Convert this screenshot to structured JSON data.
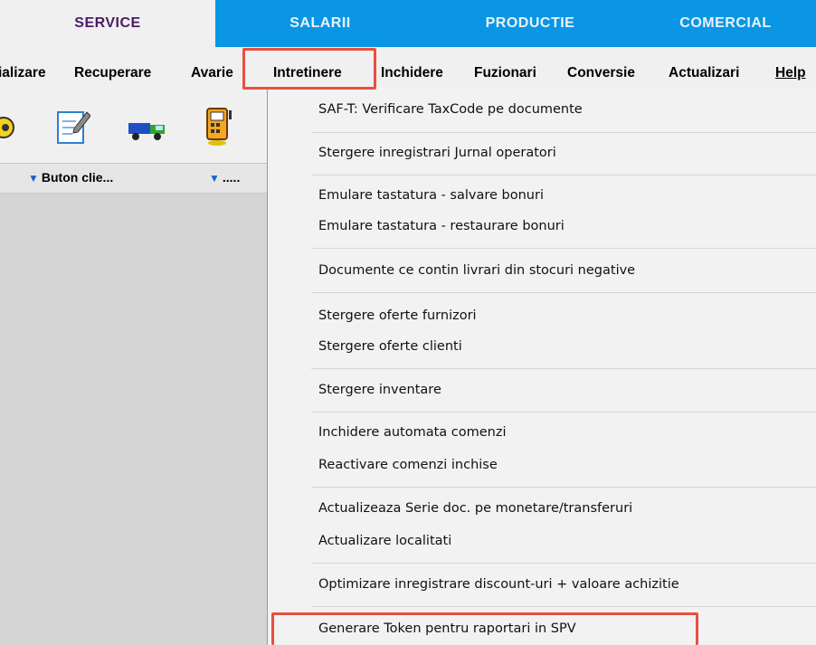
{
  "module_tabs": [
    "SERVICE",
    "SALARII",
    "PRODUCTIE",
    "COMERCIAL"
  ],
  "menu": {
    "items": [
      "ializare",
      "Recuperare",
      "Avarie",
      "Intretinere",
      "Inchidere",
      "Fuzionari",
      "Conversie",
      "Actualizari"
    ],
    "help": "Help"
  },
  "toolbar_icons": [
    "yellow-circle-icon",
    "edit-document-icon",
    "truck-icon",
    "calculator-icon"
  ],
  "columns": [
    {
      "label": "Buton clie..."
    },
    {
      "label": "....."
    }
  ],
  "dropdown": {
    "items": [
      "SAF-T: Verificare TaxCode pe documente",
      "Stergere inregistrari Jurnal operatori",
      "Emulare tastatura - salvare bonuri",
      "Emulare tastatura - restaurare bonuri",
      "Documente ce contin livrari din stocuri negative",
      "Stergere oferte furnizori",
      "Stergere oferte clienti",
      "Stergere inventare",
      "Inchidere automata comenzi",
      "Reactivare comenzi inchise",
      "Actualizeaza Serie doc. pe monetare/transferuri",
      "Actualizare localitati",
      "Optimizare inregistrare discount-uri + valoare achizitie",
      "Generare Token pentru raportari in SPV"
    ]
  },
  "colors": {
    "tab_blue": "#0a96e4",
    "active_tab_text": "#4a1a66",
    "highlight_red": "#e8503e"
  }
}
